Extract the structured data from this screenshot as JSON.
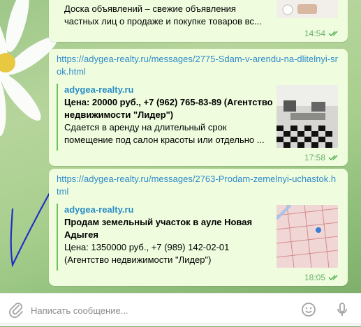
{
  "messages": [
    {
      "line1": "Доска объявлений – свежие объявления",
      "line2": "частных лиц о продаже и покупке товаров вс...",
      "time": "14:54"
    },
    {
      "url": "https://adygea-realty.ru/messages/2775-Sdam-v-arendu-na-dlitelnyi-srok.html",
      "preview_site": "adygea-realty.ru",
      "preview_title": "Цена: 20000 руб., +7 (962) 765-83-89 (Агентство недвижимости \"Лидер\")",
      "preview_desc": "Сдается в аренду на длительный срок помещение под салон красоты или отдельно ...",
      "time": "17:58"
    },
    {
      "url": "https://adygea-realty.ru/messages/2763-Prodam-zemelnyi-uchastok.html",
      "preview_site": "adygea-realty.ru",
      "preview_title": "Продам земельный участок в ауле Новая Адыгея",
      "preview_desc": "Цена: 1350000 руб., +7 (989) 142-02-01 (Агентство недвижимости \"Лидер\")",
      "time": "18:05"
    }
  ],
  "composer": {
    "placeholder": "Написать сообщение..."
  },
  "icons": {
    "attach": "paperclip-icon",
    "emoji": "smiley-icon",
    "mic": "microphone-icon",
    "read_receipt": "double-check-icon"
  },
  "colors": {
    "bubble": "#effdde",
    "link": "#2f8bc9",
    "time": "#6dae6d",
    "check": "#4fae4e"
  }
}
